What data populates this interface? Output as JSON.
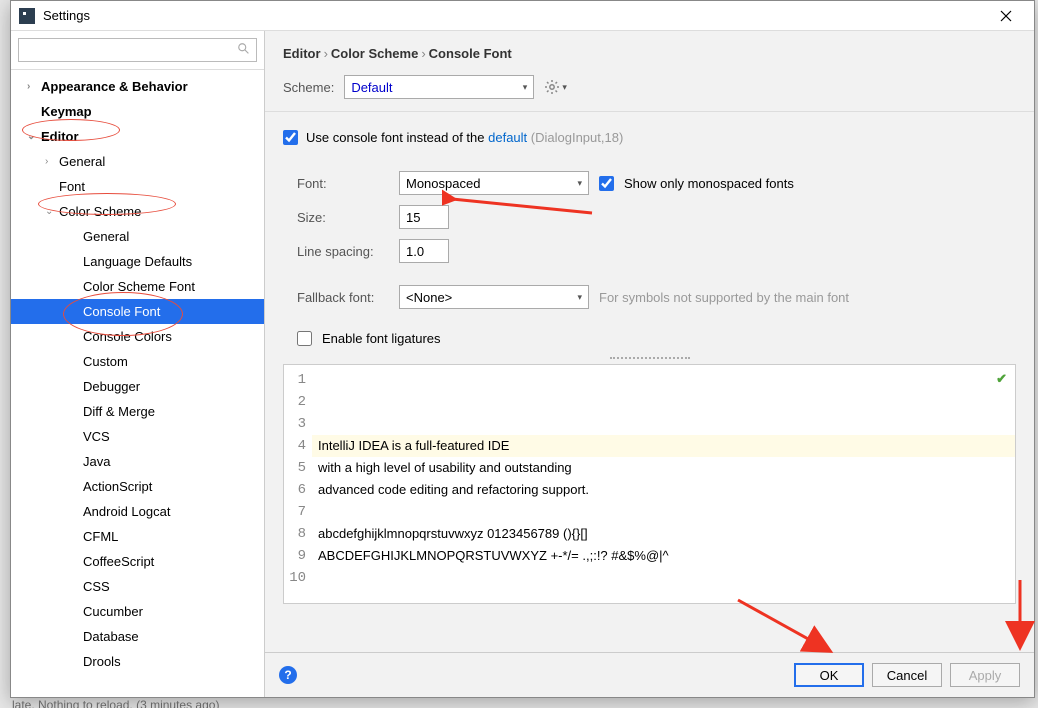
{
  "window": {
    "title": "Settings"
  },
  "search": {
    "placeholder": ""
  },
  "tree": {
    "appearance": "Appearance & Behavior",
    "keymap": "Keymap",
    "editor": "Editor",
    "general": "General",
    "font": "Font",
    "color_scheme": "Color Scheme",
    "cs_general": "General",
    "cs_lang_defaults": "Language Defaults",
    "cs_font": "Color Scheme Font",
    "cs_console_font": "Console Font",
    "cs_console_colors": "Console Colors",
    "cs_custom": "Custom",
    "cs_debugger": "Debugger",
    "cs_diff": "Diff & Merge",
    "cs_vcs": "VCS",
    "cs_java": "Java",
    "cs_as": "ActionScript",
    "cs_android": "Android Logcat",
    "cs_cfml": "CFML",
    "cs_coffee": "CoffeeScript",
    "cs_css": "CSS",
    "cs_cucumber": "Cucumber",
    "cs_database": "Database",
    "cs_drools": "Drools"
  },
  "breadcrumb": {
    "p1": "Editor",
    "p2": "Color Scheme",
    "p3": "Console Font"
  },
  "scheme": {
    "label": "Scheme:",
    "value": "Default"
  },
  "form": {
    "use_font_prefix": "Use console font instead of the ",
    "use_font_link": "default",
    "use_font_suffix": " (DialogInput,18)",
    "font_label": "Font:",
    "font_value": "Monospaced",
    "show_mono_label": "Show only monospaced fonts",
    "size_label": "Size:",
    "size_value": "15",
    "line_spacing_label": "Line spacing:",
    "line_spacing_value": "1.0",
    "fallback_label": "Fallback font:",
    "fallback_value": "<None>",
    "fallback_hint": "For symbols not supported by the main font",
    "ligatures_label": "Enable font ligatures"
  },
  "preview": {
    "lines": [
      "IntelliJ IDEA is a full-featured IDE",
      "with a high level of usability and outstanding",
      "advanced code editing and refactoring support.",
      "",
      "abcdefghijklmnopqrstuvwxyz 0123456789 (){}[]",
      "ABCDEFGHIJKLMNOPQRSTUVWXYZ +-*/= .,;:!? #&$%@|^",
      "",
      "",
      "",
      ""
    ]
  },
  "buttons": {
    "ok": "OK",
    "cancel": "Cancel",
    "apply": "Apply"
  },
  "status": "late. Nothing to reload. (3 minutes ago)"
}
